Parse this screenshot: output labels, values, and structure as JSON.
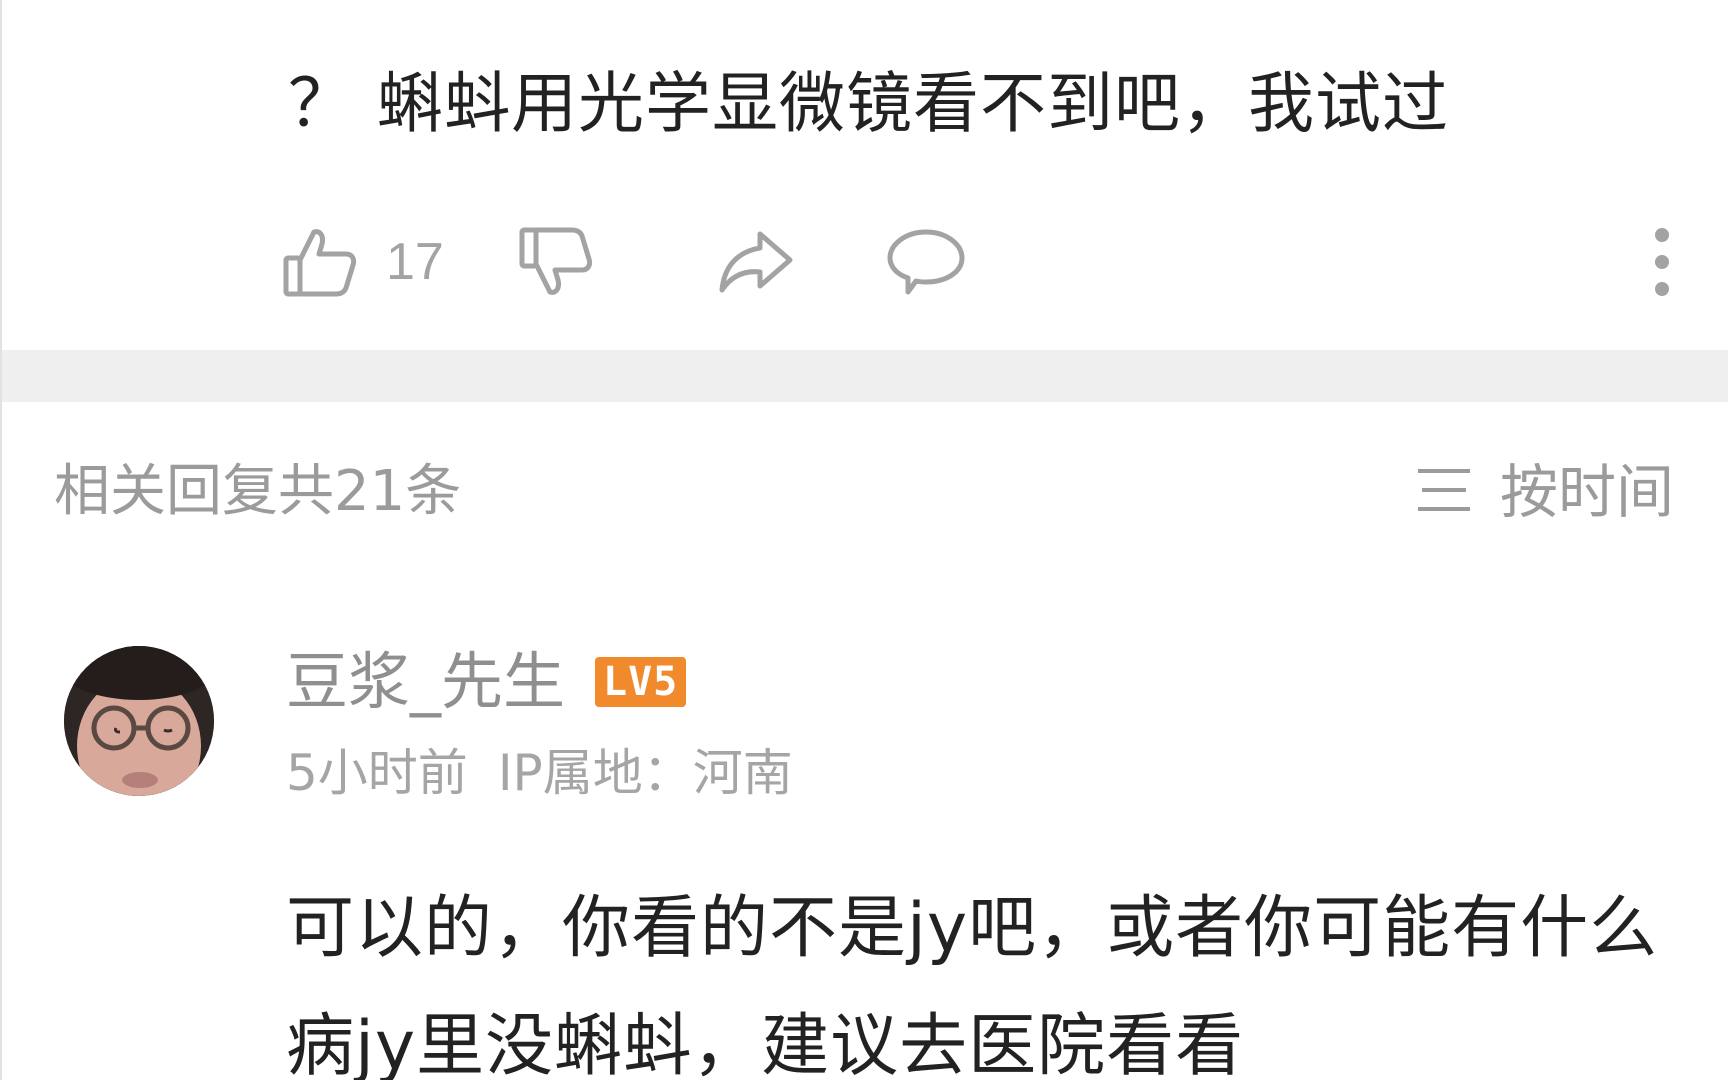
{
  "post": {
    "text": "？ 蝌蚪用光学显微镜看不到吧，我试过"
  },
  "actions": {
    "like_count": "17",
    "like_icon": "thumbs-up-icon",
    "dislike_icon": "thumbs-down-icon",
    "share_icon": "share-arrow-icon",
    "comment_icon": "comment-bubble-icon",
    "more_icon": "more-vertical-icon"
  },
  "replies": {
    "count_label": "相关回复共21条",
    "sort_icon": "sort-lines-icon",
    "sort_label": "按时间"
  },
  "reply": {
    "username": "豆浆_先生",
    "level": "LV5",
    "time": "5小时前",
    "ip_location": "IP属地：河南",
    "text": "可以的，你看的不是jy吧，或者你可能有什么病jy里没蝌蚪，建议去医院看看"
  },
  "colors": {
    "level_badge": "#f08a2c",
    "divider": "#efefef",
    "secondary_text": "#9b9b9b",
    "primary_text": "#222222"
  }
}
